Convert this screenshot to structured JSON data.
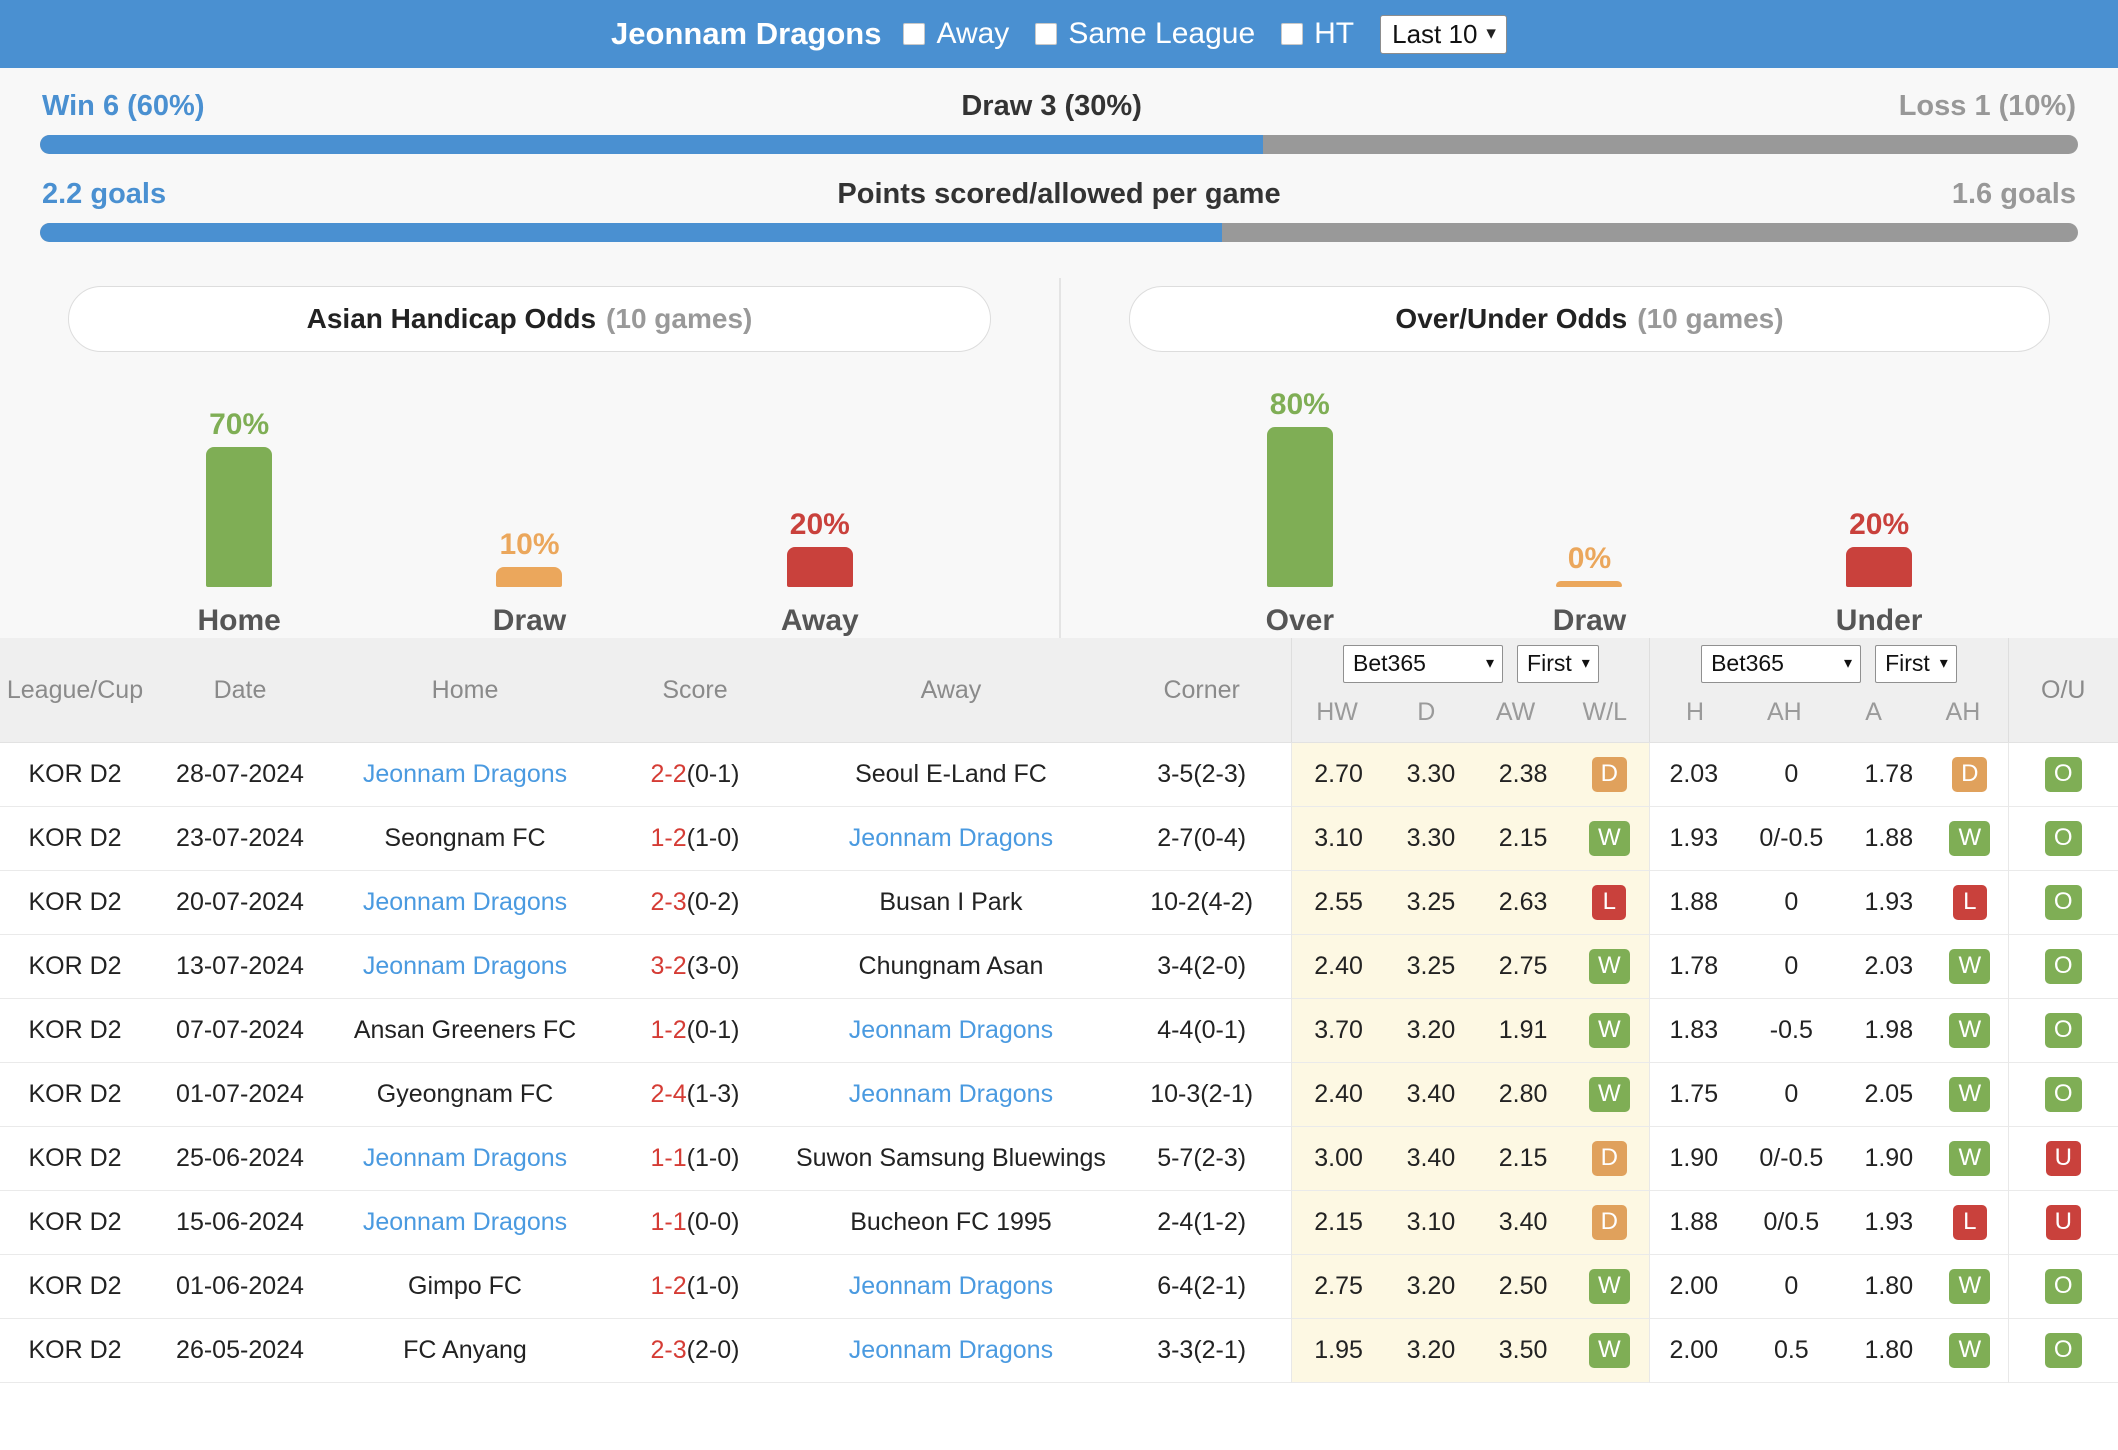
{
  "header": {
    "team": "Jeonnam Dragons",
    "checkboxes": [
      {
        "label": "Away",
        "checked": false
      },
      {
        "label": "Same League",
        "checked": false
      },
      {
        "label": "HT",
        "checked": false
      }
    ],
    "range_select": "Last 10",
    "caret": "⌄"
  },
  "summary": {
    "win": "Win 6 (60%)",
    "draw": "Draw 3 (30%)",
    "loss": "Loss 1 (10%)",
    "win_pct": 60,
    "goals_scored": "2.2 goals",
    "goals_title": "Points scored/allowed per game",
    "goals_allowed": "1.6 goals",
    "goals_pct": 58
  },
  "odds_panels": [
    {
      "title": "Asian Handicap Odds",
      "games": "(10 games)",
      "bars": [
        {
          "label": "Home",
          "pct": "70%",
          "value": 70,
          "color": "#7fae55"
        },
        {
          "label": "Draw",
          "pct": "10%",
          "value": 10,
          "color": "#eba75c"
        },
        {
          "label": "Away",
          "pct": "20%",
          "value": 20,
          "color": "#c9413c"
        }
      ]
    },
    {
      "title": "Over/Under Odds",
      "games": "(10 games)",
      "bars": [
        {
          "label": "Over",
          "pct": "80%",
          "value": 80,
          "color": "#7fae55"
        },
        {
          "label": "Draw",
          "pct": "0%",
          "value": 0,
          "color": "#eba75c"
        },
        {
          "label": "Under",
          "pct": "20%",
          "value": 20,
          "color": "#c9413c"
        }
      ]
    }
  ],
  "table": {
    "headers": {
      "league": "League/Cup",
      "date": "Date",
      "home": "Home",
      "score": "Score",
      "away": "Away",
      "corner": "Corner",
      "ou": "O/U"
    },
    "group1": {
      "bookmaker": "Bet365",
      "half": "First",
      "subs": [
        "HW",
        "D",
        "AW",
        "W/L"
      ]
    },
    "group2": {
      "bookmaker": "Bet365",
      "half": "First",
      "subs": [
        "H",
        "AH",
        "A",
        "AH"
      ]
    },
    "rows": [
      {
        "league": "KOR D2",
        "date": "28-07-2024",
        "home": "Jeonnam Dragons",
        "home_hl": true,
        "score": "2-2",
        "ht": "(0-1)",
        "away": "Seoul E-Land FC",
        "away_hl": false,
        "corner": "3-5(2-3)",
        "hw": "2.70",
        "d": "3.30",
        "aw": "2.38",
        "wl": "D",
        "h": "2.03",
        "ah1": "0",
        "a": "1.78",
        "ah2": "D",
        "ou": "O"
      },
      {
        "league": "KOR D2",
        "date": "23-07-2024",
        "home": "Seongnam FC",
        "home_hl": false,
        "score": "1-2",
        "ht": "(1-0)",
        "away": "Jeonnam Dragons",
        "away_hl": true,
        "corner": "2-7(0-4)",
        "hw": "3.10",
        "d": "3.30",
        "aw": "2.15",
        "wl": "W",
        "h": "1.93",
        "ah1": "0/-0.5",
        "a": "1.88",
        "ah2": "W",
        "ou": "O"
      },
      {
        "league": "KOR D2",
        "date": "20-07-2024",
        "home": "Jeonnam Dragons",
        "home_hl": true,
        "score": "2-3",
        "ht": "(0-2)",
        "away": "Busan I Park",
        "away_hl": false,
        "corner": "10-2(4-2)",
        "hw": "2.55",
        "d": "3.25",
        "aw": "2.63",
        "wl": "L",
        "h": "1.88",
        "ah1": "0",
        "a": "1.93",
        "ah2": "L",
        "ou": "O"
      },
      {
        "league": "KOR D2",
        "date": "13-07-2024",
        "home": "Jeonnam Dragons",
        "home_hl": true,
        "score": "3-2",
        "ht": "(3-0)",
        "away": "Chungnam Asan",
        "away_hl": false,
        "corner": "3-4(2-0)",
        "hw": "2.40",
        "d": "3.25",
        "aw": "2.75",
        "wl": "W",
        "h": "1.78",
        "ah1": "0",
        "a": "2.03",
        "ah2": "W",
        "ou": "O"
      },
      {
        "league": "KOR D2",
        "date": "07-07-2024",
        "home": "Ansan Greeners FC",
        "home_hl": false,
        "score": "1-2",
        "ht": "(0-1)",
        "away": "Jeonnam Dragons",
        "away_hl": true,
        "corner": "4-4(0-1)",
        "hw": "3.70",
        "d": "3.20",
        "aw": "1.91",
        "wl": "W",
        "h": "1.83",
        "ah1": "-0.5",
        "a": "1.98",
        "ah2": "W",
        "ou": "O"
      },
      {
        "league": "KOR D2",
        "date": "01-07-2024",
        "home": "Gyeongnam FC",
        "home_hl": false,
        "score": "2-4",
        "ht": "(1-3)",
        "away": "Jeonnam Dragons",
        "away_hl": true,
        "corner": "10-3(2-1)",
        "hw": "2.40",
        "d": "3.40",
        "aw": "2.80",
        "wl": "W",
        "h": "1.75",
        "ah1": "0",
        "a": "2.05",
        "ah2": "W",
        "ou": "O"
      },
      {
        "league": "KOR D2",
        "date": "25-06-2024",
        "home": "Jeonnam Dragons",
        "home_hl": true,
        "score": "1-1",
        "ht": "(1-0)",
        "away": "Suwon Samsung Bluewings",
        "away_hl": false,
        "corner": "5-7(2-3)",
        "hw": "3.00",
        "d": "3.40",
        "aw": "2.15",
        "wl": "D",
        "h": "1.90",
        "ah1": "0/-0.5",
        "a": "1.90",
        "ah2": "W",
        "ou": "U"
      },
      {
        "league": "KOR D2",
        "date": "15-06-2024",
        "home": "Jeonnam Dragons",
        "home_hl": true,
        "score": "1-1",
        "ht": "(0-0)",
        "away": "Bucheon FC 1995",
        "away_hl": false,
        "corner": "2-4(1-2)",
        "hw": "2.15",
        "d": "3.10",
        "aw": "3.40",
        "wl": "D",
        "h": "1.88",
        "ah1": "0/0.5",
        "a": "1.93",
        "ah2": "L",
        "ou": "U"
      },
      {
        "league": "KOR D2",
        "date": "01-06-2024",
        "home": "Gimpo FC",
        "home_hl": false,
        "score": "1-2",
        "ht": "(1-0)",
        "away": "Jeonnam Dragons",
        "away_hl": true,
        "corner": "6-4(2-1)",
        "hw": "2.75",
        "d": "3.20",
        "aw": "2.50",
        "wl": "W",
        "h": "2.00",
        "ah1": "0",
        "a": "1.80",
        "ah2": "W",
        "ou": "O"
      },
      {
        "league": "KOR D2",
        "date": "26-05-2024",
        "home": "FC Anyang",
        "home_hl": false,
        "score": "2-3",
        "ht": "(2-0)",
        "away": "Jeonnam Dragons",
        "away_hl": true,
        "corner": "3-3(2-1)",
        "hw": "1.95",
        "d": "3.20",
        "aw": "3.50",
        "wl": "W",
        "h": "2.00",
        "ah1": "0.5",
        "a": "1.80",
        "ah2": "W",
        "ou": "O"
      }
    ]
  }
}
